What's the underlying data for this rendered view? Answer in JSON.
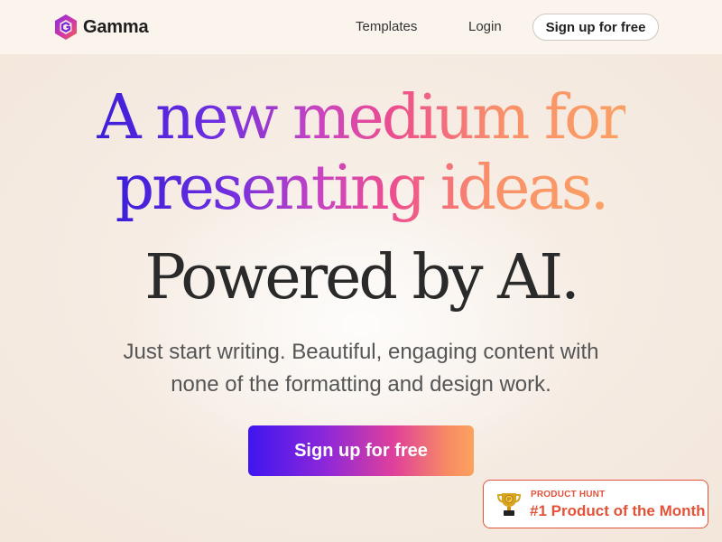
{
  "colors": {
    "accent_gradient_start": "#3f16f0",
    "accent_gradient_end": "#fca25e",
    "product_hunt": "#e3533a",
    "background": "#faf5ef"
  },
  "header": {
    "logo_icon": "gamma-logo-icon",
    "logo_text": "Gamma",
    "nav": {
      "templates": "Templates",
      "login": "Login",
      "signup": "Sign up for free"
    }
  },
  "hero": {
    "headline_line1": "A new medium for",
    "headline_line2": "presenting ideas.",
    "tagline": "Powered by AI.",
    "subtext_line1": "Just start writing. Beautiful, engaging content with",
    "subtext_line2": "none of the formatting and design work.",
    "cta_label": "Sign up for free"
  },
  "product_hunt_badge": {
    "icon": "trophy-icon",
    "label": "PRODUCT HUNT",
    "title": "#1 Product of the Month"
  }
}
